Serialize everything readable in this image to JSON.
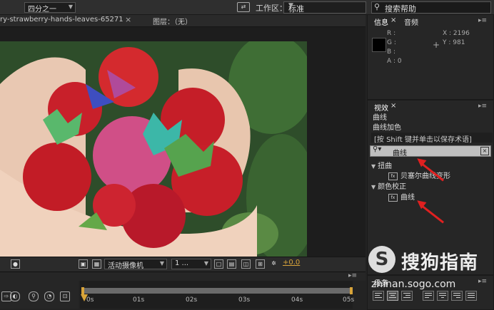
{
  "topbar": {
    "workspace_label": "工作区：",
    "workspace_value": "标准",
    "search_label": "搜索帮助"
  },
  "comp": {
    "tab_title": "ry-strawberry-hands-leaves-65271",
    "close": "×",
    "layer_tab": "图层：（无）"
  },
  "viewer_toolbar": {
    "resolution": "四分之一",
    "camera": "活动摄像机",
    "views": "1 ...",
    "exposure": "+0.0"
  },
  "timeline": {
    "ticks": [
      "0s",
      "01s",
      "02s",
      "03s",
      "04s",
      "05s"
    ]
  },
  "info_panel": {
    "tab_info": "信息",
    "tab_audio": "音频",
    "rgb_lines": "R :\nG :\nB :\nA : 0",
    "xy_lines": "X : 2196\nY : 981",
    "close": "×"
  },
  "effects_panel": {
    "tab": "视效",
    "preset_items": [
      "曲线",
      "曲线加色"
    ],
    "hint": "[按 Shift 键并单击以保存术语]",
    "search_value": "曲线",
    "categories": [
      {
        "label": "扭曲",
        "items": [
          "贝塞尔曲线变形"
        ]
      },
      {
        "label": "颜色校正",
        "items": [
          "曲线"
        ]
      }
    ]
  },
  "paragraph_panel": {
    "tab": "段落"
  },
  "watermark": {
    "logo": "S",
    "text": "搜狗指南",
    "url": "zhinan.sogo.com"
  },
  "colors": {
    "accent": "#d8a43a",
    "arrow": "#e02020",
    "panel_bg": "#262626"
  }
}
